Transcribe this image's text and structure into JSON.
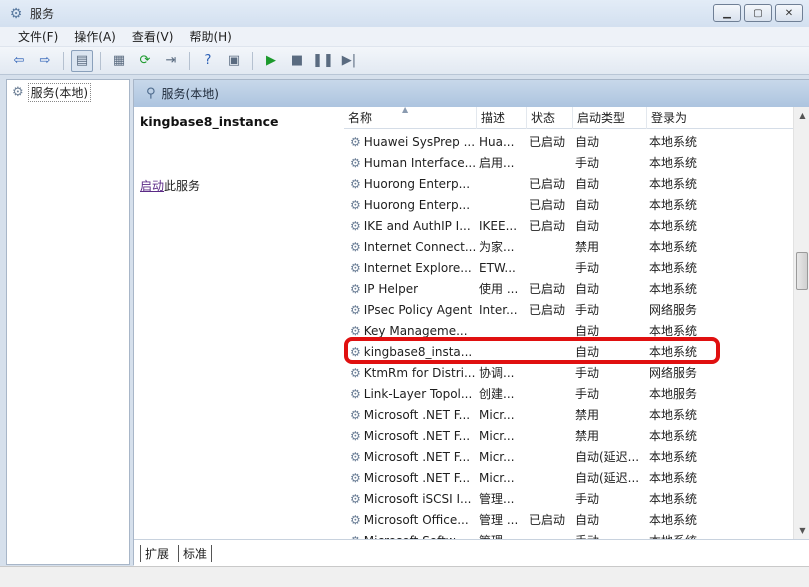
{
  "window": {
    "title": "服务"
  },
  "menu": [
    "文件(F)",
    "操作(A)",
    "查看(V)",
    "帮助(H)"
  ],
  "tree": {
    "root": "服务(本地)"
  },
  "pane": {
    "title": "服务(本地)"
  },
  "detail": {
    "service_name": "kingbase8_instance",
    "action_link": "启动",
    "action_suffix": "此服务"
  },
  "columns": {
    "name": "名称",
    "desc": "描述",
    "status": "状态",
    "start": "启动类型",
    "logon": "登录为"
  },
  "services": [
    {
      "name": "Huawei SysPrep ...",
      "desc": "Hua...",
      "status": "已启动",
      "start": "自动",
      "logon": "本地系统"
    },
    {
      "name": "Human Interface...",
      "desc": "启用...",
      "status": "",
      "start": "手动",
      "logon": "本地系统"
    },
    {
      "name": "Huorong Enterp...",
      "desc": "",
      "status": "已启动",
      "start": "自动",
      "logon": "本地系统"
    },
    {
      "name": "Huorong Enterp...",
      "desc": "",
      "status": "已启动",
      "start": "自动",
      "logon": "本地系统"
    },
    {
      "name": "IKE and AuthIP I...",
      "desc": "IKEE...",
      "status": "已启动",
      "start": "自动",
      "logon": "本地系统"
    },
    {
      "name": "Internet Connect...",
      "desc": "为家...",
      "status": "",
      "start": "禁用",
      "logon": "本地系统"
    },
    {
      "name": "Internet Explore...",
      "desc": "ETW...",
      "status": "",
      "start": "手动",
      "logon": "本地系统"
    },
    {
      "name": "IP Helper",
      "desc": "使用 ...",
      "status": "已启动",
      "start": "自动",
      "logon": "本地系统"
    },
    {
      "name": "IPsec Policy Agent",
      "desc": "Inter...",
      "status": "已启动",
      "start": "手动",
      "logon": "网络服务"
    },
    {
      "name": "Key Manageme...",
      "desc": "",
      "status": "",
      "start": "自动",
      "logon": "本地系统"
    },
    {
      "name": "kingbase8_insta...",
      "desc": "",
      "status": "",
      "start": "自动",
      "logon": "本地系统"
    },
    {
      "name": "KtmRm for Distri...",
      "desc": "协调...",
      "status": "",
      "start": "手动",
      "logon": "网络服务"
    },
    {
      "name": "Link-Layer Topol...",
      "desc": "创建...",
      "status": "",
      "start": "手动",
      "logon": "本地服务"
    },
    {
      "name": "Microsoft .NET F...",
      "desc": "Micr...",
      "status": "",
      "start": "禁用",
      "logon": "本地系统"
    },
    {
      "name": "Microsoft .NET F...",
      "desc": "Micr...",
      "status": "",
      "start": "禁用",
      "logon": "本地系统"
    },
    {
      "name": "Microsoft .NET F...",
      "desc": "Micr...",
      "status": "",
      "start": "自动(延迟...",
      "logon": "本地系统"
    },
    {
      "name": "Microsoft .NET F...",
      "desc": "Micr...",
      "status": "",
      "start": "自动(延迟...",
      "logon": "本地系统"
    },
    {
      "name": "Microsoft iSCSI I...",
      "desc": "管理...",
      "status": "",
      "start": "手动",
      "logon": "本地系统"
    },
    {
      "name": "Microsoft Office...",
      "desc": "管理 ...",
      "status": "已启动",
      "start": "自动",
      "logon": "本地系统"
    },
    {
      "name": "Microsoft Softw...",
      "desc": "管理...",
      "status": "",
      "start": "手动",
      "logon": "本地系统"
    }
  ],
  "tabs": {
    "extended": "扩展",
    "standard": "标准"
  },
  "colors": {
    "highlight": "#e01010",
    "link": "#5b2a86"
  },
  "icons": [
    "gear-icon",
    "back-arrow-icon",
    "forward-arrow-icon",
    "play-icon",
    "stop-icon",
    "pause-icon",
    "restart-icon",
    "help-icon"
  ]
}
